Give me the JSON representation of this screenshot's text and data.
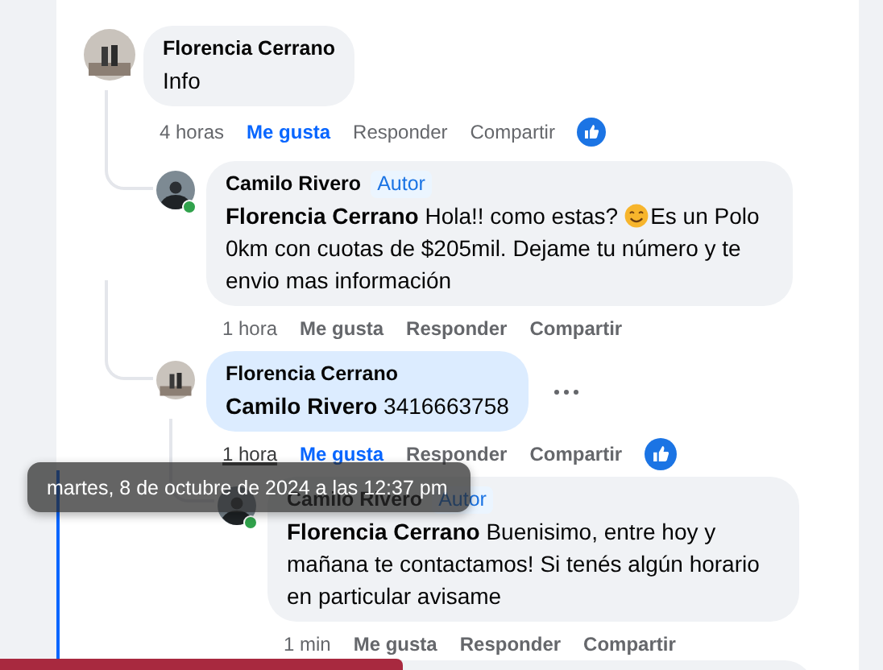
{
  "comments": [
    {
      "author": "Florencia Cerrano",
      "text": "Info",
      "time": "4 horas",
      "like": "Me gusta",
      "reply": "Responder",
      "share": "Compartir",
      "liked": true,
      "reaction": true,
      "children": [
        {
          "author": "Camilo Rivero",
          "badge": "Autor",
          "mention": "Florencia Cerrano",
          "text": "Hola!! como estas?",
          "emoji": true,
          "text_after": "Es un Polo 0km con cuotas de $205mil. Dejame tu número y te envio mas información",
          "time": "1 hora",
          "like": "Me gusta",
          "reply": "Responder",
          "share": "Compartir",
          "liked": false,
          "online": true
        },
        {
          "author": "Florencia Cerrano",
          "mention": "Camilo Rivero",
          "text": "3416663758",
          "time": "1 hora",
          "like": "Me gusta",
          "reply": "Responder",
          "share": "Compartir",
          "liked": true,
          "reaction": true,
          "highlighted": true,
          "time_hovered": true,
          "more": true,
          "children": [
            {
              "author": "Camilo Rivero",
              "badge": "Autor",
              "mention": "Florencia Cerrano",
              "text": "Buenisimo, entre hoy y mañana te contactamos! Si tenés algún horario en particular avisame",
              "time": "1 min",
              "like": "Me gusta",
              "reply": "Responder",
              "share": "Compartir",
              "liked": false,
              "online": true
            }
          ]
        }
      ]
    }
  ],
  "tooltip": {
    "text": "martes, 8 de octubre de 2024 a las 12:37 pm"
  }
}
